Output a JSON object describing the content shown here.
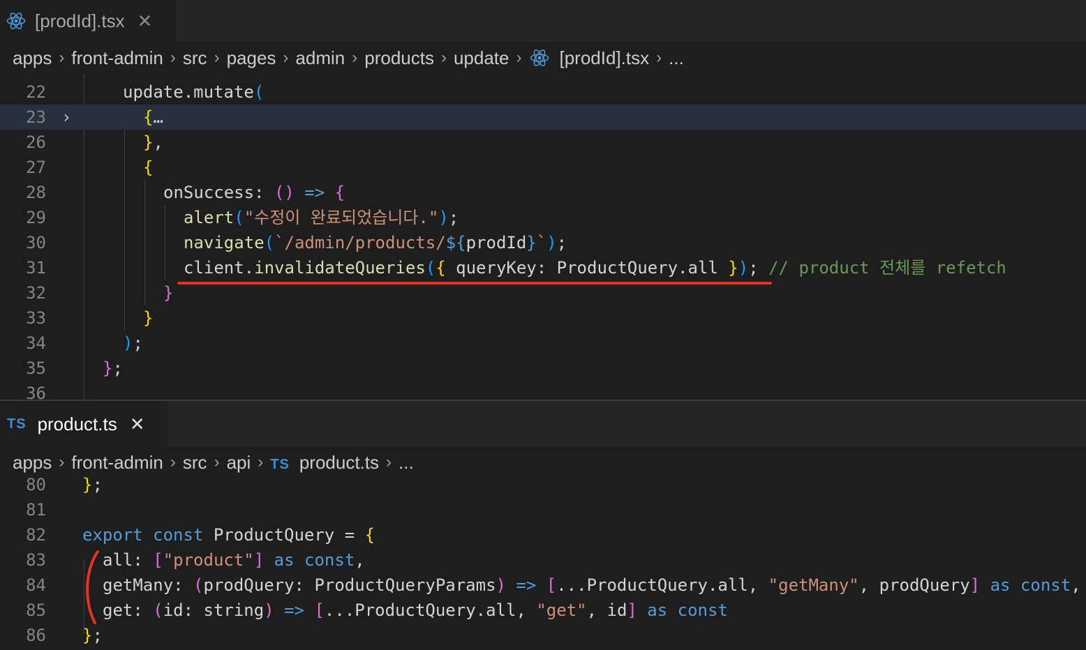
{
  "top": {
    "tab": {
      "title": "[prodId].tsx",
      "close": "✕"
    },
    "breadcrumb": [
      "apps",
      "front-admin",
      "src",
      "pages",
      "admin",
      "products",
      "update"
    ],
    "breadcrumb_file": "[prodId].tsx",
    "breadcrumb_more": "...",
    "lines": [
      {
        "n": "22",
        "tokens": [
          [
            "w",
            "update.mutate"
          ],
          [
            "b3",
            "("
          ]
        ]
      },
      {
        "n": "23",
        "tokens": [
          [
            "b1",
            "{"
          ],
          [
            "w",
            "…"
          ]
        ]
      },
      {
        "n": "26",
        "tokens": [
          [
            "b1",
            "}"
          ],
          [
            "w",
            ","
          ]
        ]
      },
      {
        "n": "27",
        "tokens": [
          [
            "b1",
            "{"
          ]
        ]
      },
      {
        "n": "28",
        "tokens": [
          [
            "w",
            "onSuccess: "
          ],
          [
            "b2",
            "()"
          ],
          [
            "k",
            " => "
          ],
          [
            "b2",
            "{"
          ]
        ]
      },
      {
        "n": "29",
        "tokens": [
          [
            "f",
            "alert"
          ],
          [
            "b3",
            "("
          ],
          [
            "s",
            "\"수정이 완료되었습니다.\""
          ],
          [
            "b3",
            ")"
          ],
          [
            "w",
            ";"
          ]
        ]
      },
      {
        "n": "30",
        "tokens": [
          [
            "f",
            "navigate"
          ],
          [
            "b3",
            "("
          ],
          [
            "s",
            "`/admin/products/"
          ],
          [
            "k",
            "${"
          ],
          [
            "w",
            "prodId"
          ],
          [
            "k",
            "}"
          ],
          [
            "s",
            "`"
          ],
          [
            "b3",
            ")"
          ],
          [
            "w",
            ";"
          ]
        ]
      },
      {
        "n": "31",
        "tokens": [
          [
            "w",
            "client."
          ],
          [
            "f",
            "invalidateQueries"
          ],
          [
            "b3",
            "("
          ],
          [
            "b1",
            "{"
          ],
          [
            "w",
            " queryKey: ProductQuery.all "
          ],
          [
            "b1",
            "}"
          ],
          [
            "b3",
            ")"
          ],
          [
            "w",
            "; "
          ],
          [
            "c",
            "// product 전체를 refetch"
          ]
        ]
      },
      {
        "n": "32",
        "tokens": [
          [
            "b2",
            "}"
          ]
        ]
      },
      {
        "n": "33",
        "tokens": [
          [
            "b1",
            "}"
          ]
        ]
      },
      {
        "n": "34",
        "tokens": [
          [
            "b3",
            ")"
          ],
          [
            "w",
            ";"
          ]
        ]
      },
      {
        "n": "35",
        "tokens": [
          [
            "b2",
            "}"
          ],
          [
            "w",
            ";"
          ]
        ]
      },
      {
        "n": "36",
        "tokens": []
      }
    ]
  },
  "bottom": {
    "tab": {
      "badge": "TS",
      "title": "product.ts",
      "close": "✕"
    },
    "breadcrumb": [
      "apps",
      "front-admin",
      "src",
      "api"
    ],
    "breadcrumb_badge": "TS",
    "breadcrumb_file": "product.ts",
    "breadcrumb_more": "...",
    "lines": [
      {
        "n": "80",
        "tokens": [
          [
            "b1",
            "}"
          ],
          [
            "w",
            ";"
          ]
        ]
      },
      {
        "n": "81",
        "tokens": []
      },
      {
        "n": "82",
        "tokens": [
          [
            "k",
            "export"
          ],
          [
            "w",
            " "
          ],
          [
            "k",
            "const"
          ],
          [
            "w",
            " ProductQuery = "
          ],
          [
            "b1",
            "{"
          ]
        ]
      },
      {
        "n": "83",
        "tokens": [
          [
            "w",
            "all: "
          ],
          [
            "b2",
            "["
          ],
          [
            "s",
            "\"product\""
          ],
          [
            "b2",
            "]"
          ],
          [
            "w",
            " "
          ],
          [
            "k",
            "as"
          ],
          [
            "w",
            " "
          ],
          [
            "k",
            "const"
          ],
          [
            "w",
            ","
          ]
        ]
      },
      {
        "n": "84",
        "tokens": [
          [
            "w",
            "getMany: "
          ],
          [
            "b2",
            "("
          ],
          [
            "w",
            "prodQuery: ProductQueryParams"
          ],
          [
            "b2",
            ")"
          ],
          [
            "k",
            " => "
          ],
          [
            "b2",
            "["
          ],
          [
            "w",
            "...ProductQuery.all, "
          ],
          [
            "s",
            "\"getMany\""
          ],
          [
            "w",
            ", prodQuery"
          ],
          [
            "b2",
            "]"
          ],
          [
            "w",
            " "
          ],
          [
            "k",
            "as"
          ],
          [
            "w",
            " "
          ],
          [
            "k",
            "const"
          ],
          [
            "w",
            ","
          ]
        ]
      },
      {
        "n": "85",
        "tokens": [
          [
            "w",
            "get: "
          ],
          [
            "b2",
            "("
          ],
          [
            "w",
            "id: string"
          ],
          [
            "b2",
            ")"
          ],
          [
            "k",
            " => "
          ],
          [
            "b2",
            "["
          ],
          [
            "w",
            "...ProductQuery.all, "
          ],
          [
            "s",
            "\"get\""
          ],
          [
            "w",
            ", id"
          ],
          [
            "b2",
            "]"
          ],
          [
            "w",
            " "
          ],
          [
            "k",
            "as"
          ],
          [
            "w",
            " "
          ],
          [
            "k",
            "const"
          ]
        ]
      },
      {
        "n": "86",
        "tokens": [
          [
            "b1",
            "}"
          ],
          [
            "w",
            ";"
          ]
        ]
      }
    ]
  },
  "colors": {
    "annotation": "#e8341c",
    "highlight": "#26313d",
    "react": "#4d9de0",
    "ts": "#3b8fd6"
  }
}
